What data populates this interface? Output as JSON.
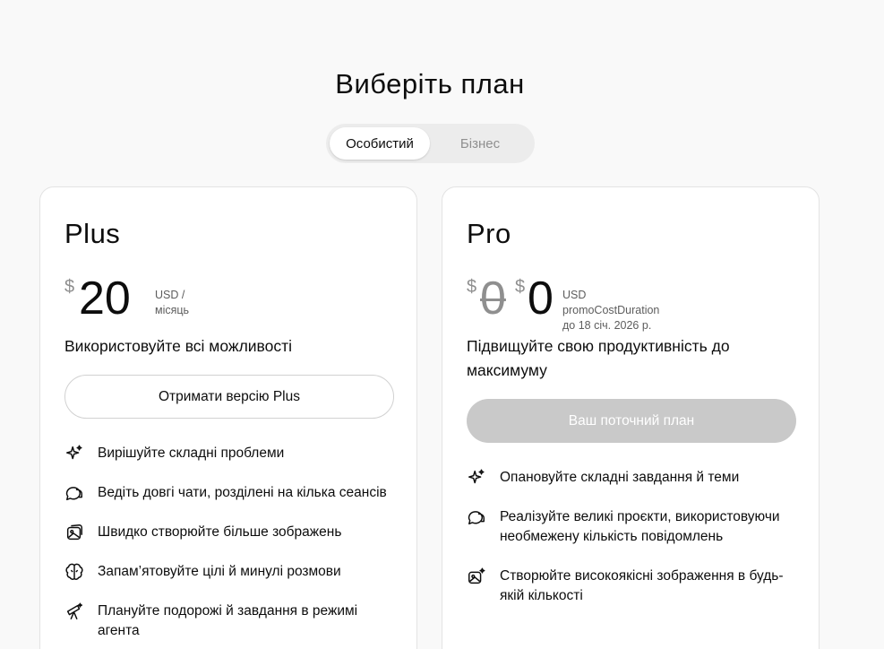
{
  "page": {
    "title": "Виберіть план"
  },
  "tabs": [
    {
      "label": "Особистий",
      "active": true
    },
    {
      "label": "Бізнес",
      "active": false
    }
  ],
  "plans": [
    {
      "name": "Plus",
      "currency_symbol": "$",
      "price": "20",
      "price_note_line1": "USD /",
      "price_note_line2": "місяць",
      "tagline": "Використовуйте всі можливості",
      "cta_label": "Отримати версію Plus",
      "features": [
        {
          "icon": "sparkles-icon",
          "text": "Вирішуйте складні проблеми"
        },
        {
          "icon": "chat-bubbles-icon",
          "text": "Ведіть довгі чати, розділені на кілька сеансів"
        },
        {
          "icon": "image-icon",
          "text": "Швидко створюйте більше зображень"
        },
        {
          "icon": "brain-icon",
          "text": "Запам’ятовуйте цілі й минулі розмови"
        },
        {
          "icon": "telescope-icon",
          "text": "Плануйте подорожі й завдання в режимі агента"
        }
      ]
    },
    {
      "name": "Pro",
      "currency_symbol": "$",
      "old_price": "0",
      "price": "0",
      "price_note_line1": "USD promoCostDuration",
      "price_note_line2": "до 18 січ. 2026 р.",
      "tagline": "Підвищуйте свою продуктивність до максимуму",
      "cta_label": "Ваш поточний план",
      "features": [
        {
          "icon": "sparkles-icon",
          "text": "Опановуйте складні завдання й теми"
        },
        {
          "icon": "chat-bubbles-icon",
          "text": "Реалізуйте великі проєкти, використовуючи необмежену кількість повідомлень"
        },
        {
          "icon": "image-sparkle-icon",
          "text": "Створюйте високоякісні зображення в будь-якій кількості"
        }
      ]
    }
  ],
  "colors": {
    "background": "#f9f9f9",
    "card": "#ffffff",
    "text": "#0d0d0d",
    "muted": "#8f8f8f",
    "disabled_button": "#c9c9c9"
  }
}
